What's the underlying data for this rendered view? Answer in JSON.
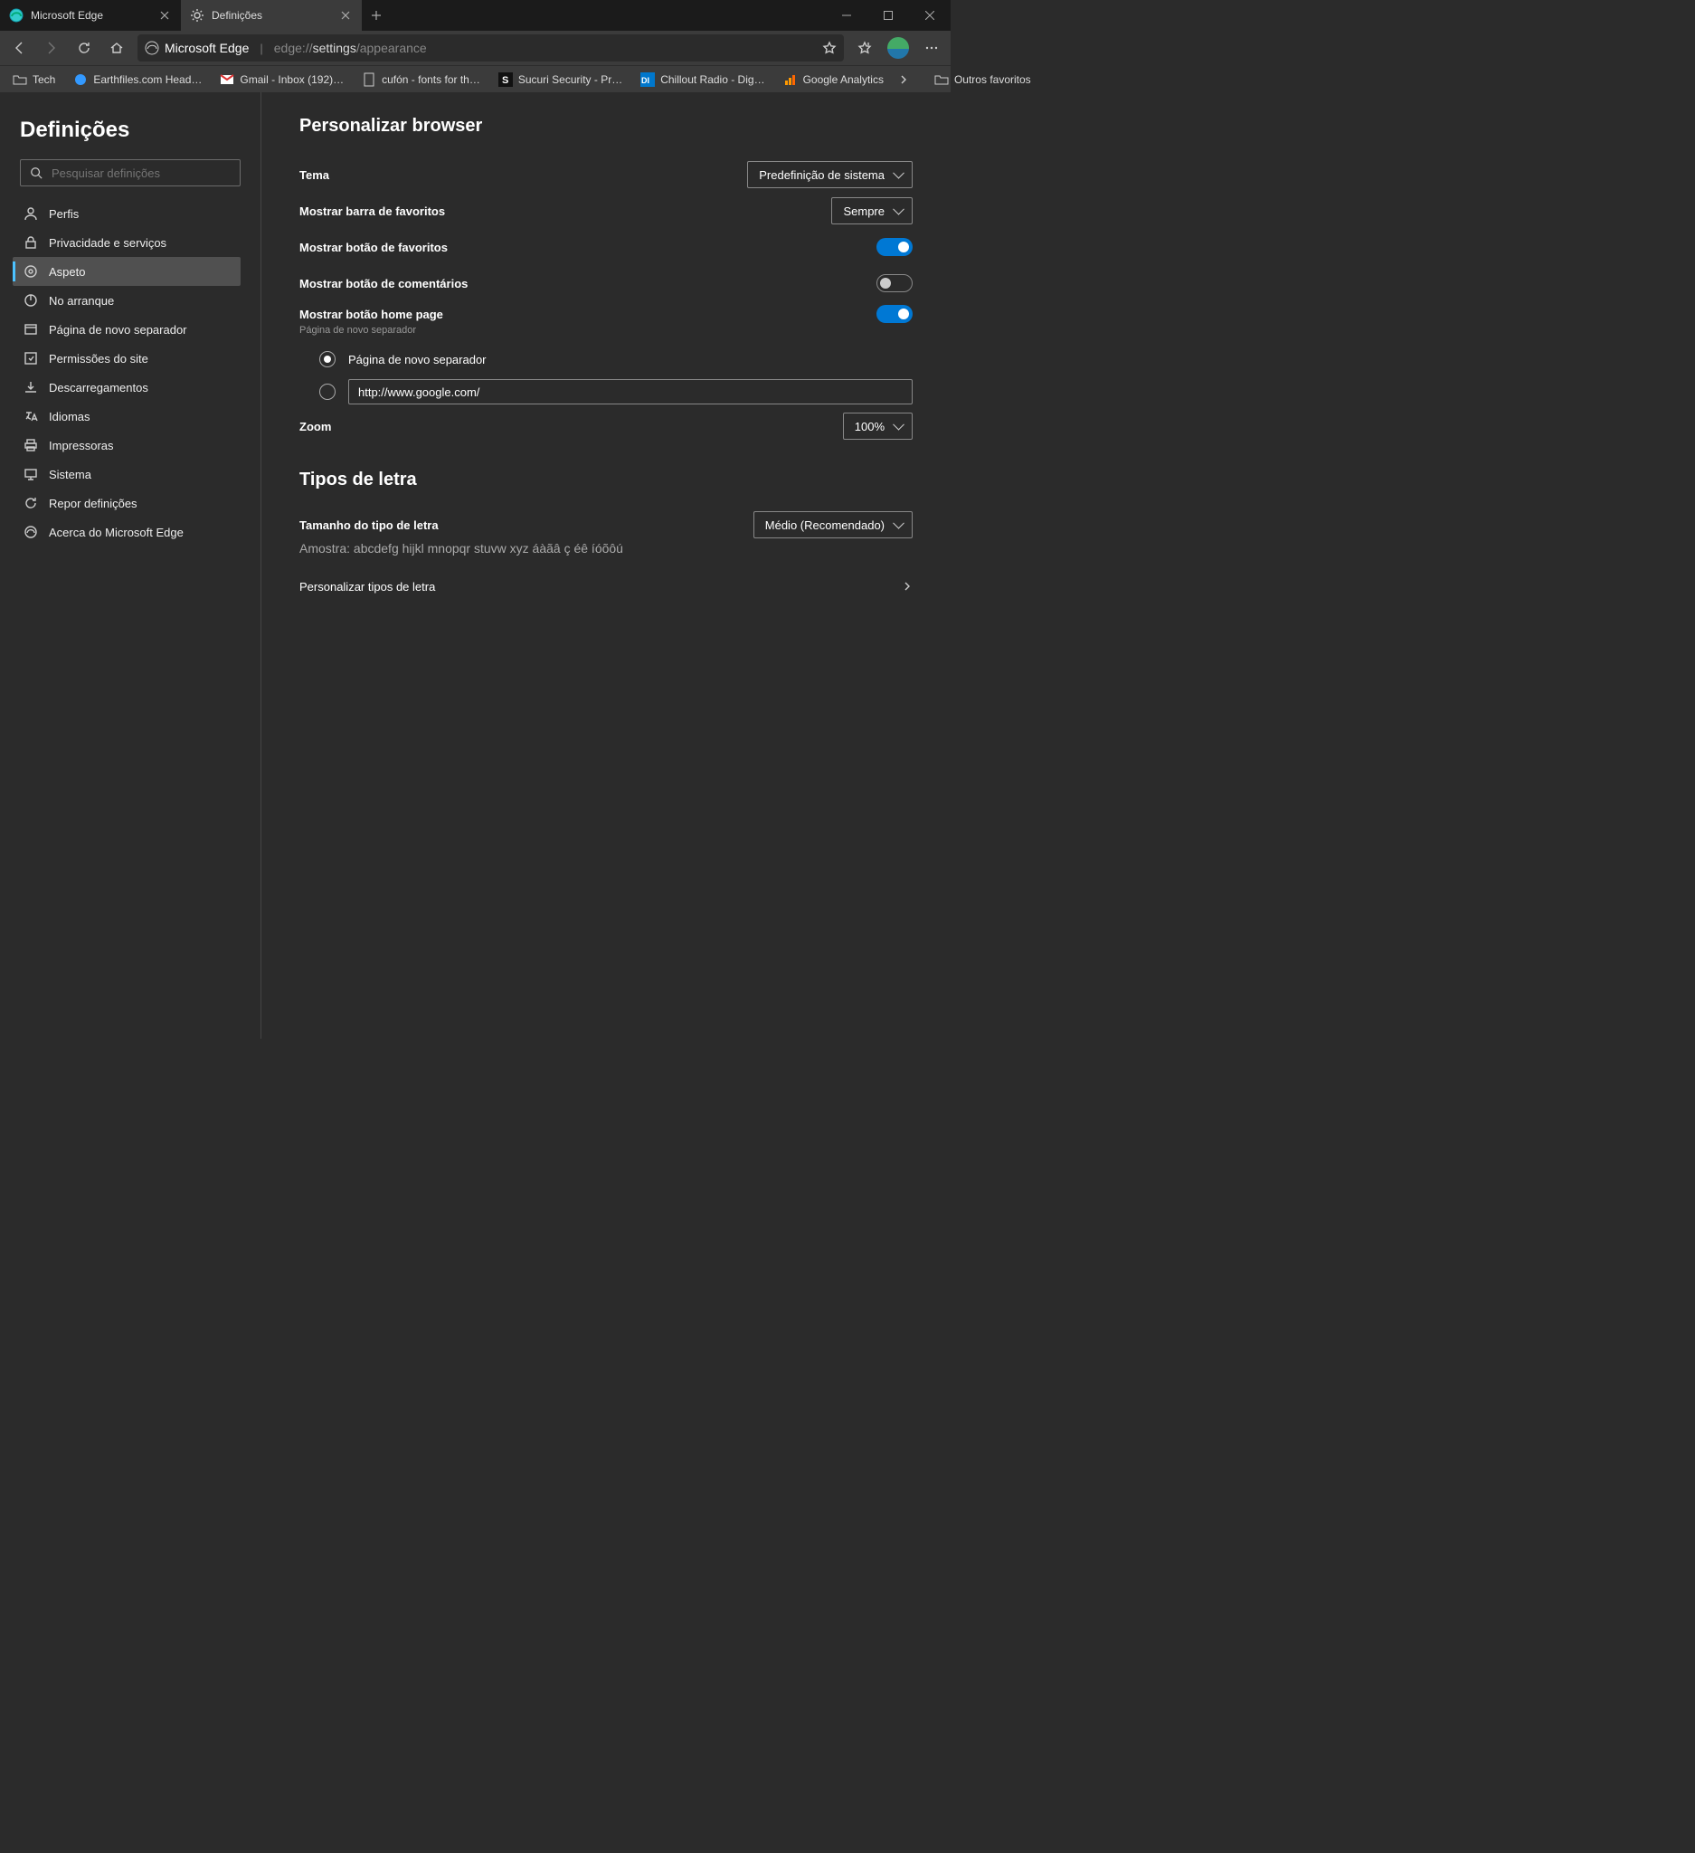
{
  "tabs": [
    {
      "label": "Microsoft Edge",
      "active": false
    },
    {
      "label": "Definições",
      "active": true
    }
  ],
  "addressbar": {
    "app_name": "Microsoft Edge",
    "url_prefix": "edge://",
    "url_mid": "settings",
    "url_suffix": "/appearance"
  },
  "bookmarks": [
    {
      "label": "Tech",
      "icon": "folder"
    },
    {
      "label": "Earthfiles.com Head…",
      "icon": "blue-dot"
    },
    {
      "label": "Gmail - Inbox (192)…",
      "icon": "gmail"
    },
    {
      "label": "cufón - fonts for th…",
      "icon": "page"
    },
    {
      "label": "Sucuri Security - Pr…",
      "icon": "sucuri"
    },
    {
      "label": "Chillout Radio - Dig…",
      "icon": "di"
    },
    {
      "label": "Google Analytics",
      "icon": "ga"
    }
  ],
  "bookmarks_other": "Outros favoritos",
  "sidebar": {
    "title": "Definições",
    "search_placeholder": "Pesquisar definições",
    "items": [
      {
        "label": "Perfis",
        "active": false
      },
      {
        "label": "Privacidade e serviços",
        "active": false
      },
      {
        "label": "Aspeto",
        "active": true
      },
      {
        "label": "No arranque",
        "active": false
      },
      {
        "label": "Página de novo separador",
        "active": false
      },
      {
        "label": "Permissões do site",
        "active": false
      },
      {
        "label": "Descarregamentos",
        "active": false
      },
      {
        "label": "Idiomas",
        "active": false
      },
      {
        "label": "Impressoras",
        "active": false
      },
      {
        "label": "Sistema",
        "active": false
      },
      {
        "label": "Repor definições",
        "active": false
      },
      {
        "label": "Acerca do Microsoft Edge",
        "active": false
      }
    ]
  },
  "content": {
    "section1_title": "Personalizar browser",
    "theme_label": "Tema",
    "theme_value": "Predefinição de sistema",
    "favbar_label": "Mostrar barra de favoritos",
    "favbar_value": "Sempre",
    "favbtn_label": "Mostrar botão de favoritos",
    "favbtn_on": true,
    "feedback_label": "Mostrar botão de comentários",
    "feedback_on": false,
    "home_label": "Mostrar botão home page",
    "home_on": true,
    "home_sub": "Página de novo separador",
    "radio_newtab": "Página de novo separador",
    "radio_newtab_selected": true,
    "homepage_url": "http://www.google.com/",
    "zoom_label": "Zoom",
    "zoom_value": "100%",
    "section2_title": "Tipos de letra",
    "fontsize_label": "Tamanho do tipo de letra",
    "fontsize_value": "Médio (Recomendado)",
    "sample_text": "Amostra: abcdefg hijkl mnopqr stuvw xyz áàãâ ç éê íóõôú",
    "customize_fonts": "Personalizar tipos de letra"
  }
}
